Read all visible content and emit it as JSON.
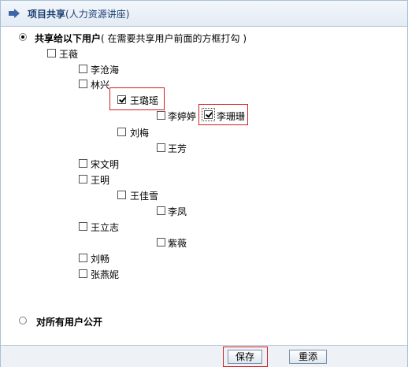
{
  "header": {
    "title": "项目共享",
    "subtitle": "(人力资源讲座)"
  },
  "share_selected": {
    "label": "共享给以下用户",
    "hint": "( 在需要共享用户前面的方框打勾 )",
    "selected": true
  },
  "share_all": {
    "label": "对所有用户公开",
    "selected": false
  },
  "tree": [
    {
      "label": "王薇",
      "checked": false
    },
    {
      "label": "李沧海",
      "checked": false
    },
    {
      "label": "林兴",
      "checked": false
    },
    {
      "label": "王璐瑶",
      "checked": true
    },
    {
      "label": "李婷婷",
      "checked": false
    },
    {
      "label": "李珊珊",
      "checked": true
    },
    {
      "label": "刘梅",
      "checked": false
    },
    {
      "label": "王芳",
      "checked": false
    },
    {
      "label": "宋文明",
      "checked": false
    },
    {
      "label": "王明",
      "checked": false
    },
    {
      "label": "王佳雪",
      "checked": false
    },
    {
      "label": "李凤",
      "checked": false
    },
    {
      "label": "王立志",
      "checked": false
    },
    {
      "label": "紫薇",
      "checked": false
    },
    {
      "label": "刘畅",
      "checked": false
    },
    {
      "label": "张燕妮",
      "checked": false
    }
  ],
  "buttons": {
    "save": "保存",
    "reset": "重添"
  },
  "colors": {
    "accent": "#1c3f73",
    "highlight": "#d21f1f",
    "border": "#a9bfd6"
  }
}
